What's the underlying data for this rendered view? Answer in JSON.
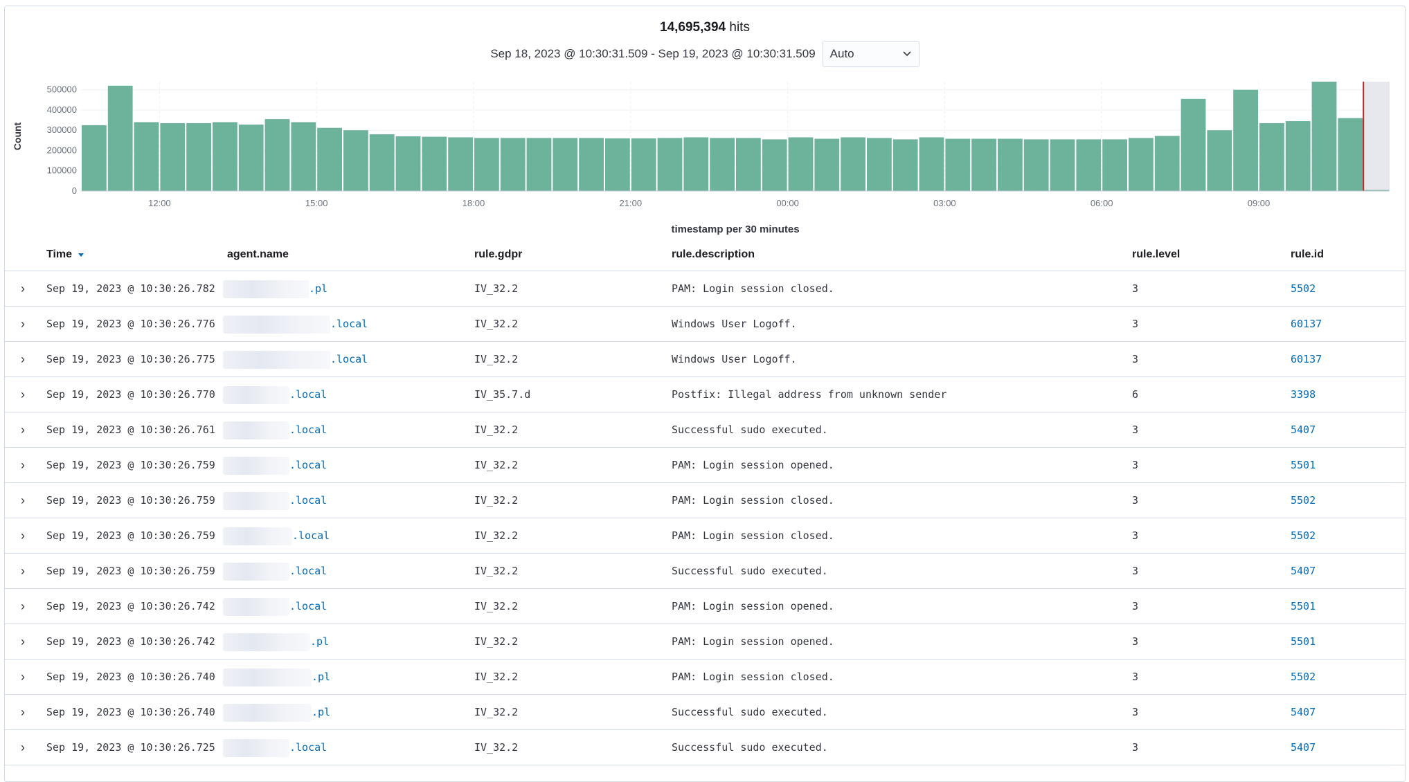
{
  "header": {
    "hits_count": "14,695,394",
    "hits_label": "hits",
    "range_text": "Sep 18, 2023 @ 10:30:31.509 - Sep 19, 2023 @ 10:30:31.509",
    "interval_value": "Auto"
  },
  "chart_data": {
    "type": "bar",
    "ylabel": "Count",
    "xlabel": "timestamp per 30 minutes",
    "ylim": [
      0,
      540000
    ],
    "y_ticks": [
      "0",
      "100000",
      "200000",
      "300000",
      "400000",
      "500000"
    ],
    "x_ticks": [
      "12:00",
      "15:00",
      "18:00",
      "21:00",
      "00:00",
      "03:00",
      "06:00",
      "09:00"
    ],
    "values": [
      325000,
      520000,
      340000,
      335000,
      335000,
      340000,
      328000,
      355000,
      340000,
      312000,
      300000,
      280000,
      270000,
      268000,
      265000,
      262000,
      262000,
      262000,
      262000,
      262000,
      260000,
      260000,
      262000,
      265000,
      262000,
      262000,
      255000,
      265000,
      258000,
      265000,
      262000,
      255000,
      265000,
      258000,
      258000,
      258000,
      255000,
      255000,
      255000,
      255000,
      262000,
      272000,
      455000,
      300000,
      500000,
      335000,
      345000,
      540000,
      360000,
      5000
    ],
    "bar_color": "#6db39b",
    "current_bucket_marker_color": "#bd271e"
  },
  "table": {
    "columns": [
      "Time",
      "agent.name",
      "rule.gdpr",
      "rule.description",
      "rule.level",
      "rule.id"
    ],
    "rows": [
      {
        "time": "Sep 19, 2023 @ 10:30:26.782",
        "agent_suffix": ".pl",
        "gdpr": "IV_32.2",
        "description": "PAM: Login session closed.",
        "level": "3",
        "id": "5502"
      },
      {
        "time": "Sep 19, 2023 @ 10:30:26.776",
        "agent_suffix": ".local",
        "gdpr": "IV_32.2",
        "description": "Windows User Logoff.",
        "level": "3",
        "id": "60137"
      },
      {
        "time": "Sep 19, 2023 @ 10:30:26.775",
        "agent_suffix": ".local",
        "gdpr": "IV_32.2",
        "description": "Windows User Logoff.",
        "level": "3",
        "id": "60137"
      },
      {
        "time": "Sep 19, 2023 @ 10:30:26.770",
        "agent_suffix": ".local",
        "gdpr": "IV_35.7.d",
        "description": "Postfix: Illegal address from unknown sender",
        "level": "6",
        "id": "3398"
      },
      {
        "time": "Sep 19, 2023 @ 10:30:26.761",
        "agent_suffix": ".local",
        "gdpr": "IV_32.2",
        "description": "Successful sudo executed.",
        "level": "3",
        "id": "5407"
      },
      {
        "time": "Sep 19, 2023 @ 10:30:26.759",
        "agent_suffix": ".local",
        "gdpr": "IV_32.2",
        "description": "PAM: Login session opened.",
        "level": "3",
        "id": "5501"
      },
      {
        "time": "Sep 19, 2023 @ 10:30:26.759",
        "agent_suffix": ".local",
        "gdpr": "IV_32.2",
        "description": "PAM: Login session closed.",
        "level": "3",
        "id": "5502"
      },
      {
        "time": "Sep 19, 2023 @ 10:30:26.759",
        "agent_suffix": ".local",
        "gdpr": "IV_32.2",
        "description": "PAM: Login session closed.",
        "level": "3",
        "id": "5502"
      },
      {
        "time": "Sep 19, 2023 @ 10:30:26.759",
        "agent_suffix": ".local",
        "gdpr": "IV_32.2",
        "description": "Successful sudo executed.",
        "level": "3",
        "id": "5407"
      },
      {
        "time": "Sep 19, 2023 @ 10:30:26.742",
        "agent_suffix": ".local",
        "gdpr": "IV_32.2",
        "description": "PAM: Login session opened.",
        "level": "3",
        "id": "5501"
      },
      {
        "time": "Sep 19, 2023 @ 10:30:26.742",
        "agent_suffix": ".pl",
        "gdpr": "IV_32.2",
        "description": "PAM: Login session opened.",
        "level": "3",
        "id": "5501"
      },
      {
        "time": "Sep 19, 2023 @ 10:30:26.740",
        "agent_suffix": ".pl",
        "gdpr": "IV_32.2",
        "description": "PAM: Login session closed.",
        "level": "3",
        "id": "5502"
      },
      {
        "time": "Sep 19, 2023 @ 10:30:26.740",
        "agent_suffix": ".pl",
        "gdpr": "IV_32.2",
        "description": "Successful sudo executed.",
        "level": "3",
        "id": "5407"
      },
      {
        "time": "Sep 19, 2023 @ 10:30:26.725",
        "agent_suffix": ".local",
        "gdpr": "IV_32.2",
        "description": "Successful sudo executed.",
        "level": "3",
        "id": "5407"
      }
    ]
  }
}
